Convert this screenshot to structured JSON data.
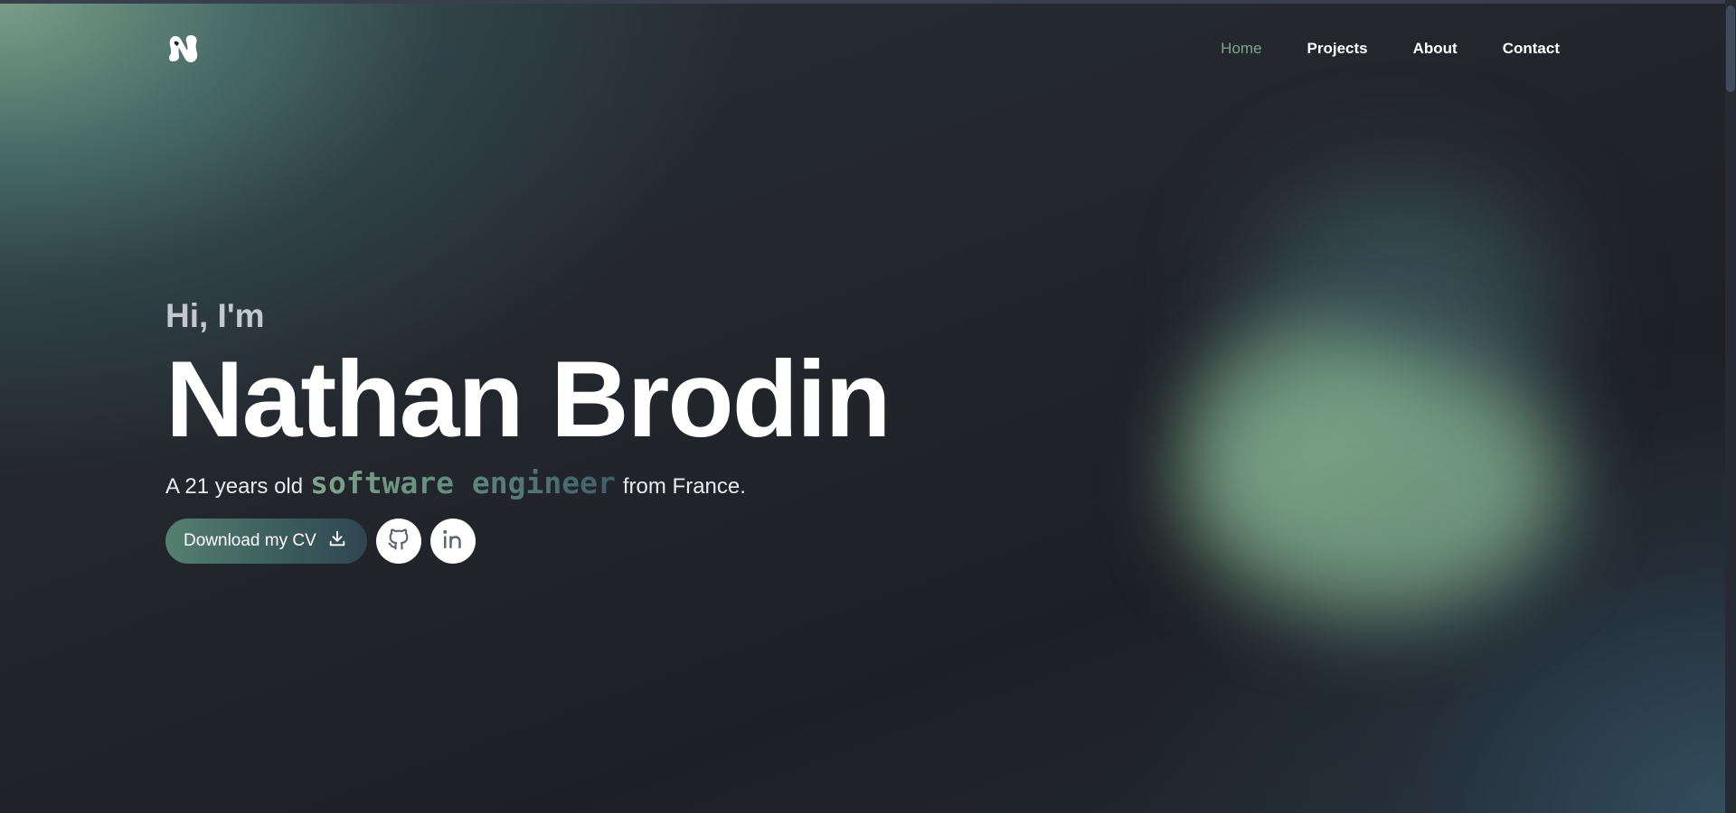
{
  "nav": {
    "items": [
      {
        "label": "Home",
        "active": true
      },
      {
        "label": "Projects",
        "active": false
      },
      {
        "label": "About",
        "active": false
      },
      {
        "label": "Contact",
        "active": false
      }
    ]
  },
  "hero": {
    "greeting": "Hi, I'm",
    "name": "Nathan Brodin",
    "tagline_prefix": "A 21 years old",
    "tagline_role": "software engineer",
    "tagline_suffix": "from France."
  },
  "actions": {
    "cv_label": "Download my CV",
    "cv_icon": "download-icon",
    "social_icons": [
      "github-icon",
      "linkedin-icon"
    ]
  },
  "theme": {
    "accent": "#7ea58a",
    "background": "#1f2127",
    "text": "#ffffff"
  }
}
